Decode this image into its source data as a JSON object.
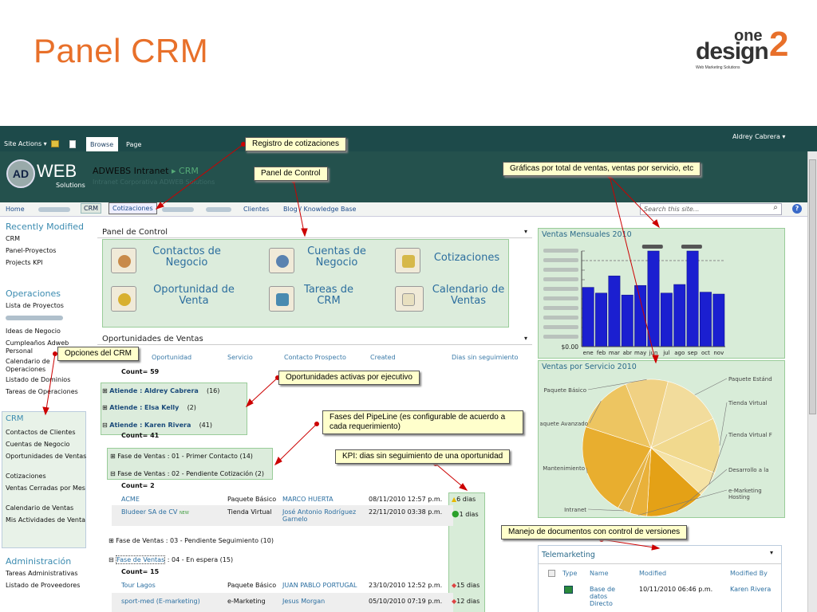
{
  "slide": {
    "title": "Panel CRM",
    "logo": {
      "line1": "one",
      "line2": "design",
      "number": "2",
      "tagline": "Web Marketing Solutions"
    }
  },
  "topbar": {
    "site_actions": "Site Actions ▾",
    "tab_browse": "Browse",
    "tab_page": "Page",
    "user": "Aldrey Cabrera ▾"
  },
  "banner": {
    "logo_circle": "AD",
    "logo_text": "WEB",
    "logo_sub": "Solutions",
    "site_name": "ADWEBS Intranet",
    "site_sep": "▸",
    "site_crumb": "CRM",
    "site_desc": "Intranet Corporativa ADWEB Solutions"
  },
  "nav": {
    "home": "Home",
    "crm": "CRM",
    "cotizaciones": "Cotizaciones",
    "clientes": "Clientes",
    "blog": "Blog / Knowledge Base",
    "search_placeholder": "Search this site...",
    "search_icon": "magnifier-icon",
    "help": "?"
  },
  "left_nav": {
    "recent_title": "Recently Modified",
    "recent": [
      "CRM",
      "Panel-Proyectos",
      "Projects KPI"
    ],
    "operaciones_title": "Operaciones",
    "operaciones": [
      "Lista de Proyectos",
      "Ideas de Negocio",
      "Cumpleaños Adweb Personal",
      "Calendario de Operaciones",
      "Listado de Dominios",
      "Tareas de Operaciones"
    ],
    "crm_title": "CRM",
    "crm": [
      "Contactos de Clientes",
      "Cuentas de Negocio",
      "Oportunidades de Ventas",
      "Cotizaciones",
      "Ventas Cerradas por Mes",
      "Calendario de Ventas",
      "Mis Actividades de Venta"
    ],
    "admin_title": "Administración",
    "admin": [
      "Tareas Administrativas",
      "Listado de Proveedores"
    ]
  },
  "panel_control": {
    "title": "Panel de Control",
    "items": [
      {
        "label": "Contactos de Negocio",
        "icon": "contacts-icon"
      },
      {
        "label": "Cuentas de Negocio",
        "icon": "accounts-icon"
      },
      {
        "label": "Cotizaciones",
        "icon": "quote-icon"
      },
      {
        "label": "Oportunidad de Venta",
        "icon": "opportunity-icon"
      },
      {
        "label": "Tareas de CRM",
        "icon": "tasks-icon"
      },
      {
        "label": "Calendario de Ventas",
        "icon": "calendar-icon"
      }
    ]
  },
  "opportunities": {
    "title": "Oportunidades de Ventas",
    "columns": [
      "Oportunidad",
      "Servicio",
      "Contacto Prospecto",
      "Created",
      "Dias sin seguimiento"
    ],
    "count_total": "Count= 59",
    "groups": [
      {
        "label": "Atiende : Aldrey Cabrera",
        "count": "(16)"
      },
      {
        "label": "Atiende : Elsa Kelly",
        "count": "(2)"
      },
      {
        "label": "Atiende : Karen Rivera",
        "count": "(41)"
      }
    ],
    "count_karen": "Count= 41",
    "phase1": "Fase de Ventas : 01 - Primer Contacto (14)",
    "phase2": "Fase de Ventas : 02 - Pendiente Cotización (2)",
    "count_phase2": "Count= 2",
    "rows_phase2": [
      {
        "name": "ACME",
        "servicio": "Paquete Básico",
        "contacto": "MARCO HUERTA",
        "created": "08/11/2010 12:57 p.m.",
        "dias": "6 dias",
        "kpi": "warning"
      },
      {
        "name": "Bludeer SA de CV",
        "new": "NEW",
        "servicio": "Tienda Virtual",
        "contacto": "José Antonio Rodríguez Garnelo",
        "created": "22/11/2010 03:38 p.m.",
        "dias": "1 dias",
        "kpi": "ok"
      }
    ],
    "phase3": "Fase de Ventas : 03 - Pendiente Seguimiento (10)",
    "phase4_link": "Fase de Ventas",
    "phase4_rest": " : 04 - En espera (15)",
    "count_phase4": "Count= 15",
    "rows_phase4": [
      {
        "name": "Tour Lagos",
        "servicio": "Paquete Básico",
        "contacto": "JUAN PABLO PORTUGAL",
        "created": "23/10/2010 12:52 p.m.",
        "dias": "15 dias",
        "kpi": "alert"
      },
      {
        "name": "sport-med (E-marketing)",
        "servicio": "e-Marketing",
        "contacto": "Jesus Morgan",
        "created": "05/10/2010 07:19 p.m.",
        "dias": "12 dias",
        "kpi": "alert"
      }
    ]
  },
  "charts": {
    "ventas_title": "Ventas Mensuales 2010",
    "servicio_title": "Ventas por Servicio 2010",
    "telemarketing_title": "Telemarketing"
  },
  "chart_data": [
    {
      "type": "bar",
      "title": "Ventas Mensuales 2010",
      "categories": [
        "ene",
        "feb",
        "mar",
        "abr",
        "may",
        "jun",
        "jul",
        "ago",
        "sep",
        "oct",
        "nov"
      ],
      "values": [
        0.62,
        0.56,
        0.74,
        0.54,
        0.64,
        1.0,
        0.56,
        0.65,
        1.0,
        0.57,
        0.55
      ],
      "yticks_visible": [
        "$0.00"
      ],
      "note": "y-axis currency labels are blurred in the screenshot; values are relative heights",
      "color": "#1b1fd0"
    },
    {
      "type": "pie",
      "title": "Ventas por Servicio 2010",
      "labels": [
        "Paquete Estánd",
        "Tienda Virtual",
        "Tienda Virtual F",
        "Desarrollo a la",
        "e-Marketing Hosting",
        "Intranet",
        "Mantenimiento",
        "Paquete Avanzado",
        "Paquete Básico"
      ],
      "values": [
        14,
        13,
        6,
        14,
        4,
        3,
        22,
        14,
        10
      ],
      "colors": [
        "#f2dc9c",
        "#f1d98e",
        "#f5e2a4",
        "#e4a116",
        "#e9b13a",
        "#e5b447",
        "#e8ae2f",
        "#edc561",
        "#f0d183"
      ]
    }
  ],
  "telemarketing": {
    "columns": [
      "Type",
      "Name",
      "Modified",
      "Modified By"
    ],
    "rows": [
      {
        "name": "Base de datos Directo",
        "modified": "10/11/2010 06:46 p.m.",
        "by": "Karen Rivera"
      }
    ]
  },
  "callouts": {
    "registro": "Registro de cotizaciones",
    "panel": "Panel de Control",
    "graficas": "Gráficas por total de ventas, ventas por servicio, etc",
    "opciones": "Opciones del CRM",
    "activas": "Oportunidades activas por ejecutivo",
    "fases": "Fases del PipeLine (es configurable de acuerdo a cada requerimiento)",
    "kpi": "KPI: dias sin seguimiento de una oportunidad",
    "documentos": "Manejo de documentos con control de versiones"
  }
}
